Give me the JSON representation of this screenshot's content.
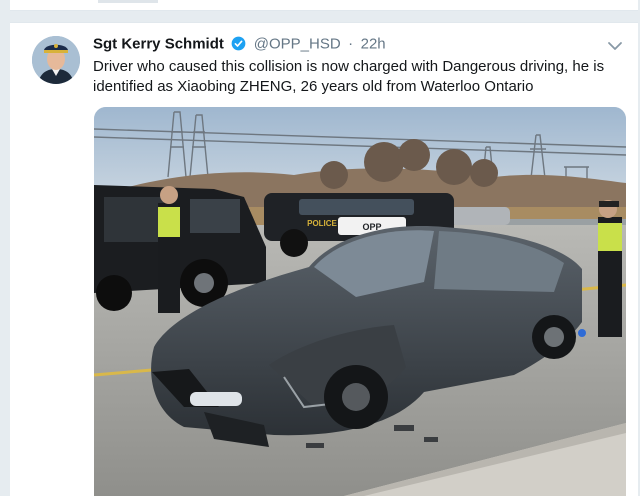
{
  "tweet": {
    "display_name": "Sgt Kerry Schmidt",
    "handle": "@OPP_HSD",
    "separator": "·",
    "time": "22h",
    "text": "Driver who caused this collision is now charged with Dangerous driving, he is identified as Xiaobing ZHENG, 26 years old from Waterloo Ontario",
    "photo": {
      "police_label_1": "POLICE",
      "police_label_2": "OPP"
    }
  },
  "icons": {
    "verified": "verified-badge-icon",
    "chevron": "chevron-down-icon"
  },
  "colors": {
    "background": "#e6ecf0",
    "card": "#ffffff",
    "verified": "#1da1f2",
    "name": "#14171a",
    "muted": "#657786"
  }
}
